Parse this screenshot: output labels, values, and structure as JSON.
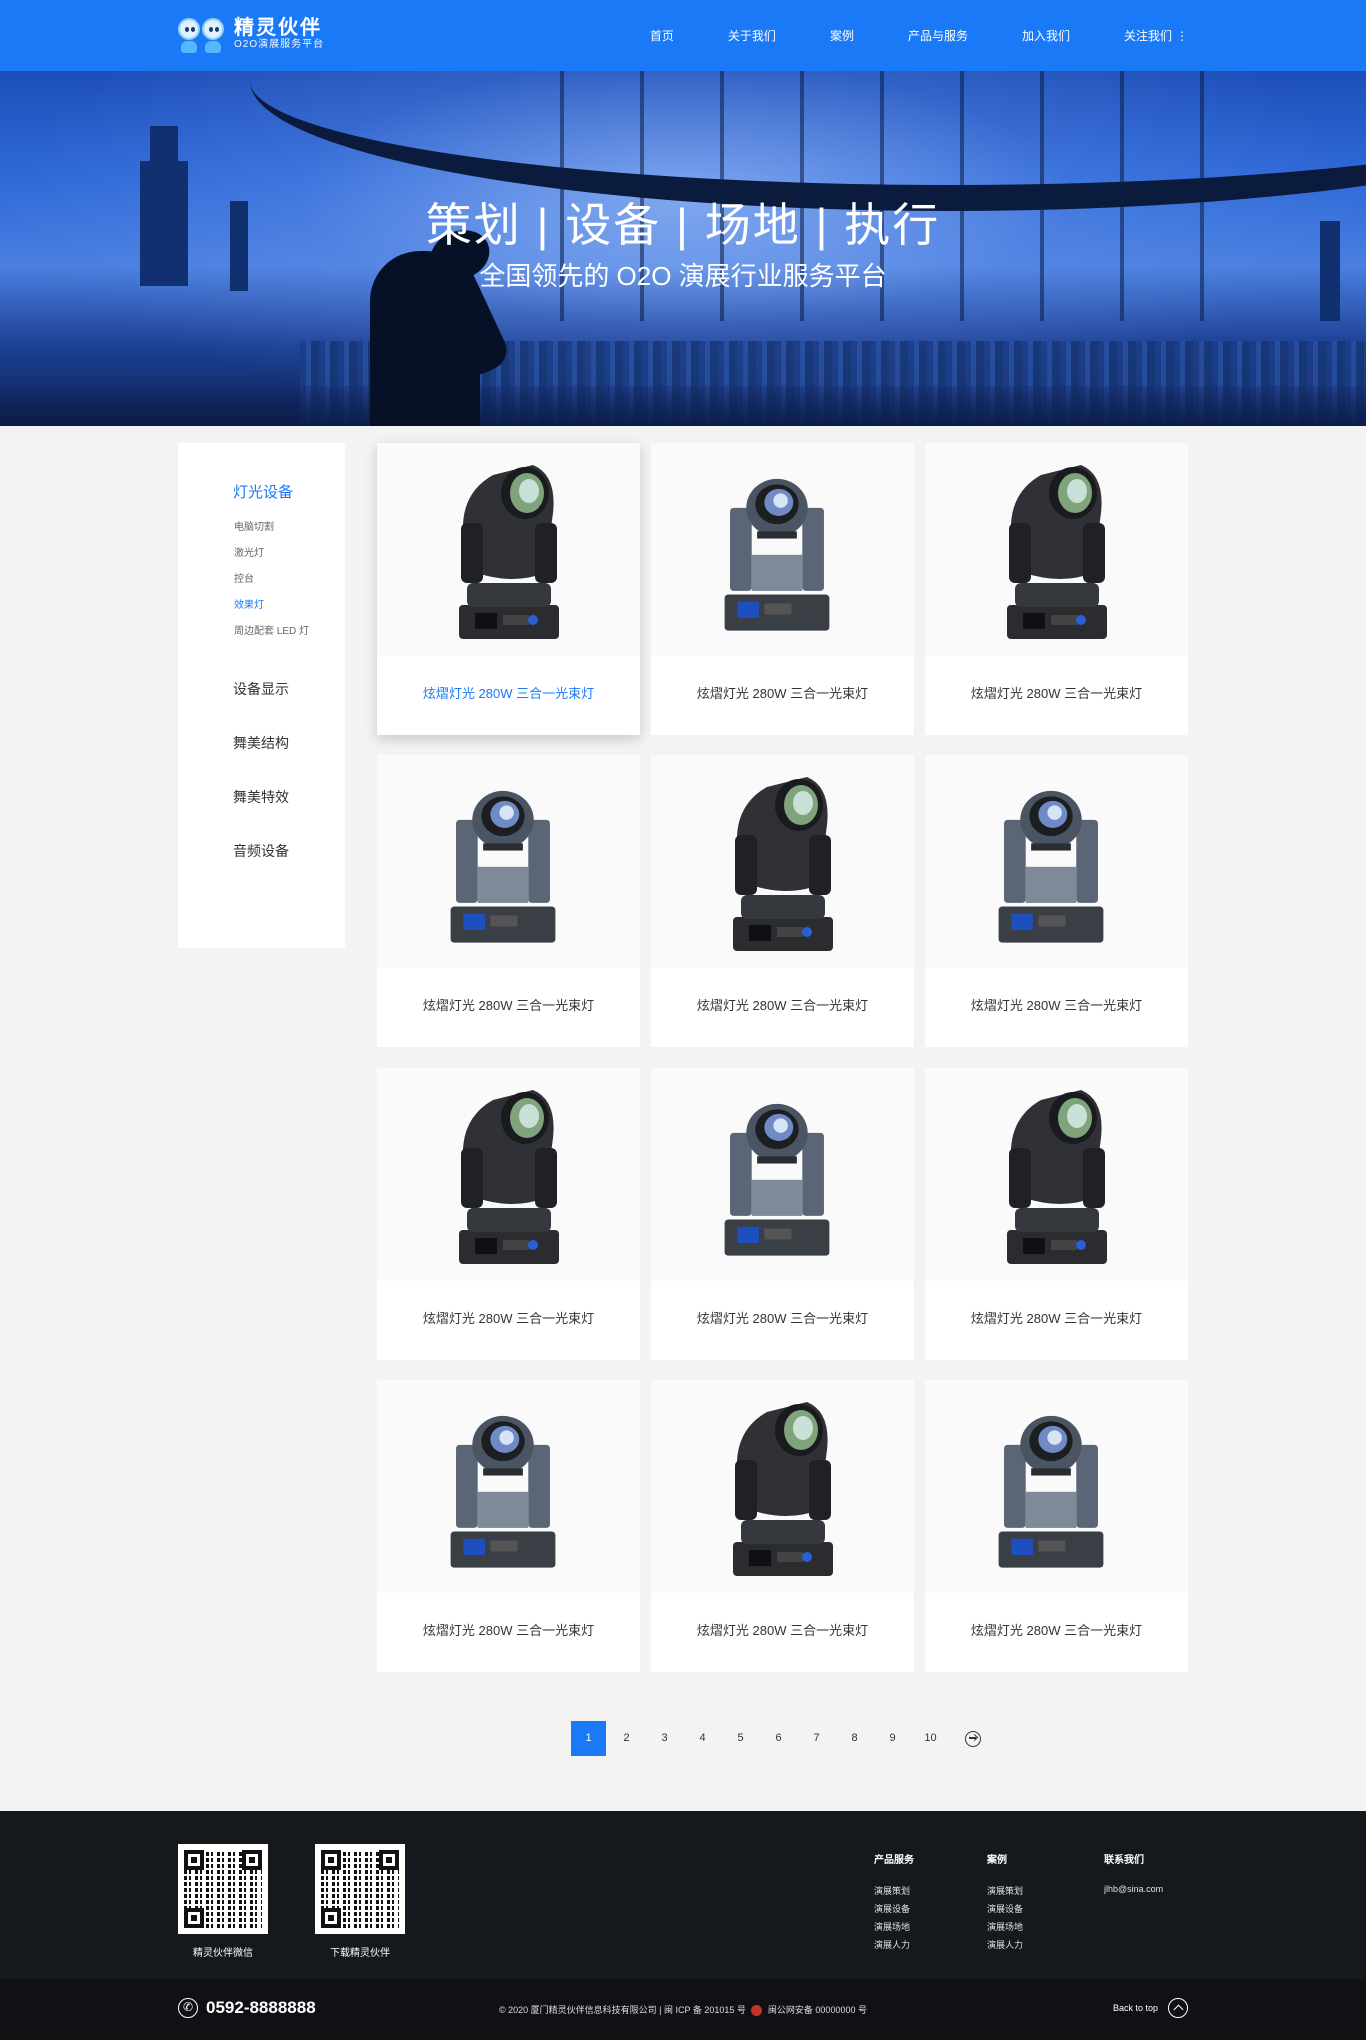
{
  "header": {
    "logo_title": "精灵伙伴",
    "logo_subtitle": "O2O演展服务平台",
    "brand_color": "#1a79f7",
    "nav": [
      {
        "label": "首页"
      },
      {
        "label": "关于我们"
      },
      {
        "label": "案例"
      },
      {
        "label": "产品与服务"
      },
      {
        "label": "加入我们"
      },
      {
        "label": "关注我们"
      }
    ]
  },
  "banner": {
    "title": "策划 | 设备 | 场地 | 执行",
    "subtitle": "全国领先的 O2O 演展行业服务平台"
  },
  "sidebar": {
    "active_category": "灯光设备",
    "subcategories": [
      {
        "label": "电脑切割"
      },
      {
        "label": "激光灯"
      },
      {
        "label": "控台"
      },
      {
        "label": "效果灯",
        "active": true
      },
      {
        "label": "周边配套 LED 灯"
      }
    ],
    "categories": [
      {
        "label": "设备显示"
      },
      {
        "label": "舞美结构"
      },
      {
        "label": "舞美特效"
      },
      {
        "label": "音频设备"
      }
    ]
  },
  "products": [
    {
      "name": "炫熠灯光 280W 三合一光束灯",
      "image": "moving-head-light-black",
      "highlighted": true
    },
    {
      "name": "炫熠灯光 280W 三合一光束灯",
      "image": "moving-head-light-grey"
    },
    {
      "name": "炫熠灯光 280W 三合一光束灯",
      "image": "moving-head-light-black"
    },
    {
      "name": "炫熠灯光 280W 三合一光束灯",
      "image": "moving-head-light-grey"
    },
    {
      "name": "炫熠灯光 280W 三合一光束灯",
      "image": "moving-head-light-black"
    },
    {
      "name": "炫熠灯光 280W 三合一光束灯",
      "image": "moving-head-light-grey"
    },
    {
      "name": "炫熠灯光 280W 三合一光束灯",
      "image": "moving-head-light-black"
    },
    {
      "name": "炫熠灯光 280W 三合一光束灯",
      "image": "moving-head-light-grey"
    },
    {
      "name": "炫熠灯光 280W 三合一光束灯",
      "image": "moving-head-light-black"
    },
    {
      "name": "炫熠灯光 280W 三合一光束灯",
      "image": "moving-head-light-grey"
    },
    {
      "name": "炫熠灯光 280W 三合一光束灯",
      "image": "moving-head-light-black"
    },
    {
      "name": "炫熠灯光 280W 三合一光束灯",
      "image": "moving-head-light-grey"
    }
  ],
  "pagination": {
    "current": "1",
    "pages": [
      "1",
      "2",
      "3",
      "4",
      "5",
      "6",
      "7",
      "8",
      "9",
      "10"
    ],
    "next_icon": "arrow-right-circle-icon"
  },
  "footer": {
    "qr_codes": [
      {
        "label": "精灵伙伴微信"
      },
      {
        "label": "下载精灵伙伴"
      }
    ],
    "columns": [
      {
        "title": "产品服务",
        "links": [
          "演展策划",
          "演展设备",
          "演展场地",
          "演展人力"
        ]
      },
      {
        "title": "案例",
        "links": [
          "演展策划",
          "演展设备",
          "演展场地",
          "演展人力"
        ]
      },
      {
        "title": "联系我们",
        "links": [
          "jlhb@sina.com"
        ]
      }
    ],
    "phone": "0592-8888888",
    "copyright_left": "© 2020  厦门精灵伙伴信息科技有限公司 | 闽 ICP 备 201015 号",
    "copyright_right": "闽公网安备 00000000 号",
    "back_to_top": "Back to top"
  }
}
